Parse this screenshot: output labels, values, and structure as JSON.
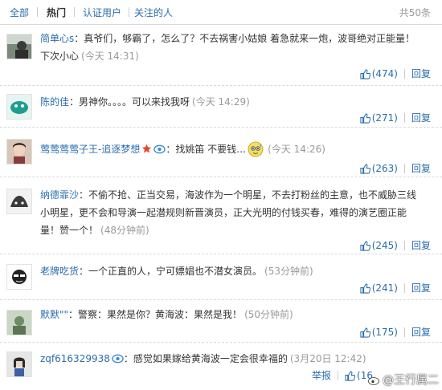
{
  "tabs": {
    "all": "全部",
    "hot": "热门",
    "verified": "认证用户",
    "following": "关注的人"
  },
  "total": "共50条",
  "comments": [
    {
      "user": "简单心s",
      "text_line1": "：真爷们，够霸了，怎么了？不去祸害小姑娘 着急就来一炮，波哥绝对正能量！",
      "text_line2": "下次小心",
      "time": "(今天 14:31)",
      "likes": "(474)",
      "reply": "回复"
    },
    {
      "user": "陈的佳",
      "text": "：男神你。。。。可以来找我呀",
      "time": "(今天 14:29)",
      "likes": "(271)",
      "reply": "回复"
    },
    {
      "user": "莺莺莺莺子王-追逐梦想",
      "text": "：找姚笛 不要钱…",
      "time": "(今天 14:26)",
      "likes": "(263)",
      "reply": "回复"
    },
    {
      "user": "纳德霏沙",
      "text_line1": "：不偷不抢、正当交易，海波作为一个明星，不去打粉丝的主意，也不威胁三线",
      "text_line2": "小明星，更不会和导演一起潜规则新晋演员，正大光明的付钱买春，难得的演艺圈正能",
      "text_line3": "量！赞一个！",
      "time": "(48分钟前)",
      "likes": "(245)",
      "reply": "回复"
    },
    {
      "user": "老牌吃货",
      "text": "：一个正直的人，宁可嫖娼也不潜女演员。",
      "time": "(53分钟前)",
      "likes": "(241)",
      "reply": "回复"
    },
    {
      "user": "默默\"\"",
      "text": "：警察：果然是你？黄海波：果然是我！",
      "time": "(50分钟前)",
      "likes": "(175)",
      "reply": "回复"
    },
    {
      "user": "zqf616329938",
      "text": "：感觉如果嫁给黄海波一定会很幸福的",
      "time": "(3月20日 12:42)",
      "likes": "(16",
      "report": "举报"
    }
  ],
  "watermark": {
    "at": "@",
    "name": "王行属二"
  },
  "colors": {
    "link": "#2b6dad",
    "muted": "#999999",
    "text": "#333333",
    "vip_badge": "#e8452c"
  }
}
